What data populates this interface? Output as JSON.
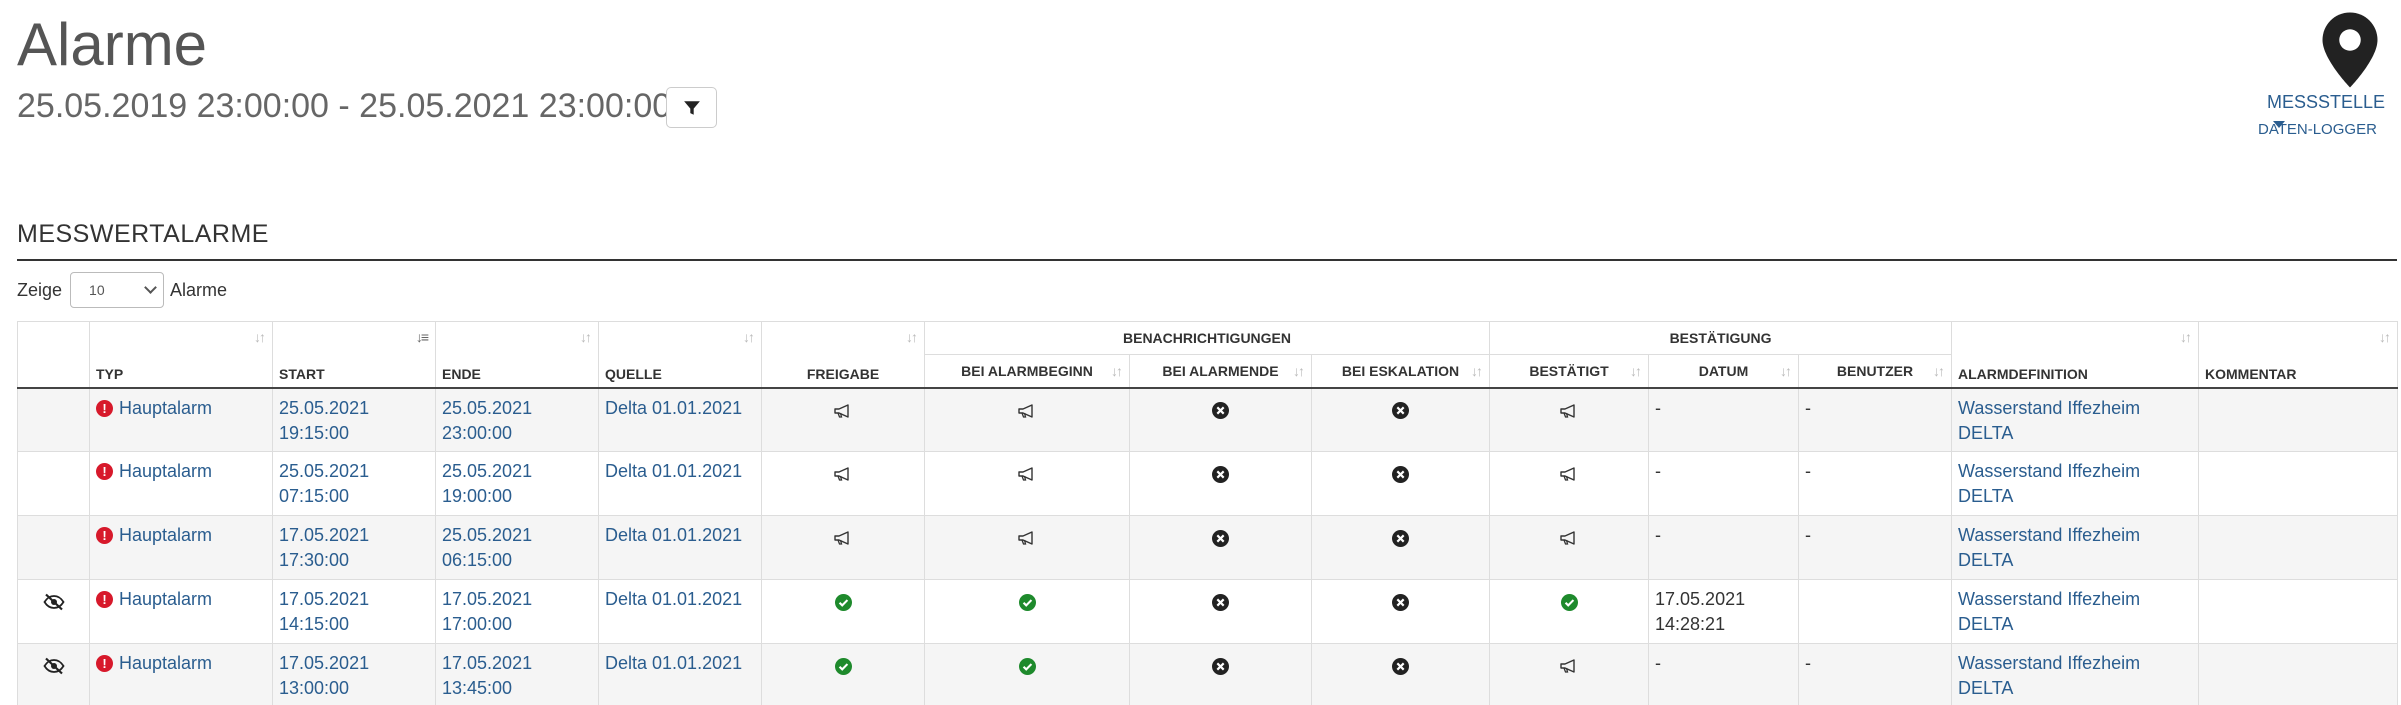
{
  "header": {
    "title": "Alarme",
    "date_range": "25.05.2019 23:00:00 - 25.05.2021 23:00:00",
    "messstelle_label": "MESSSTELLE",
    "datenlogger_label": "DATEN-LOGGER"
  },
  "section": {
    "title": "MESSWERTALARME",
    "length_prefix": "Zeige",
    "length_value": "10",
    "length_suffix": "Alarme"
  },
  "table": {
    "groups": {
      "benachrichtigungen": "BENACHRICHTIGUNGEN",
      "bestaetigung": "BESTÄTIGUNG"
    },
    "columns": {
      "typ": "TYP",
      "start": "START",
      "ende": "ENDE",
      "quelle": "QUELLE",
      "freigabe": "FREIGABE",
      "bei_alarmbeginn": "BEI ALARMBEGINN",
      "bei_alarmende": "BEI ALARMENDE",
      "bei_eskalation": "BEI ESKALATION",
      "bestaetigt": "BESTÄTIGT",
      "datum": "DATUM",
      "benutzer": "BENUTZER",
      "alarmdefinition": "ALARMDEFINITION",
      "kommentar": "KOMMENTAR"
    },
    "rows": [
      {
        "hidden_icon": "none",
        "typ": "Hauptalarm",
        "start_date": "25.05.2021",
        "start_time": "19:15:00",
        "end_date": "25.05.2021",
        "end_time": "23:00:00",
        "quelle": "Delta 01.01.2021",
        "freigabe": "megaphone-icon",
        "bei_alarmbeginn": "megaphone-icon",
        "bei_alarmende": "x-circle-icon",
        "bei_eskalation": "x-circle-icon",
        "bestaetigt": "megaphone-icon",
        "datum_date": "-",
        "datum_time": "",
        "benutzer": "-",
        "alarmdefinition": "Wasserstand Iffezheim DELTA",
        "kommentar": ""
      },
      {
        "hidden_icon": "none",
        "typ": "Hauptalarm",
        "start_date": "25.05.2021",
        "start_time": "07:15:00",
        "end_date": "25.05.2021",
        "end_time": "19:00:00",
        "quelle": "Delta 01.01.2021",
        "freigabe": "megaphone-icon",
        "bei_alarmbeginn": "megaphone-icon",
        "bei_alarmende": "x-circle-icon",
        "bei_eskalation": "x-circle-icon",
        "bestaetigt": "megaphone-icon",
        "datum_date": "-",
        "datum_time": "",
        "benutzer": "-",
        "alarmdefinition": "Wasserstand Iffezheim DELTA",
        "kommentar": ""
      },
      {
        "hidden_icon": "none",
        "typ": "Hauptalarm",
        "start_date": "17.05.2021",
        "start_time": "17:30:00",
        "end_date": "25.05.2021",
        "end_time": "06:15:00",
        "quelle": "Delta 01.01.2021",
        "freigabe": "megaphone-icon",
        "bei_alarmbeginn": "megaphone-icon",
        "bei_alarmende": "x-circle-icon",
        "bei_eskalation": "x-circle-icon",
        "bestaetigt": "megaphone-icon",
        "datum_date": "-",
        "datum_time": "",
        "benutzer": "-",
        "alarmdefinition": "Wasserstand Iffezheim DELTA",
        "kommentar": ""
      },
      {
        "hidden_icon": "eye-slash-icon",
        "typ": "Hauptalarm",
        "start_date": "17.05.2021",
        "start_time": "14:15:00",
        "end_date": "17.05.2021",
        "end_time": "17:00:00",
        "quelle": "Delta 01.01.2021",
        "freigabe": "check-circle-icon",
        "bei_alarmbeginn": "check-circle-icon",
        "bei_alarmende": "x-circle-icon",
        "bei_eskalation": "x-circle-icon",
        "bestaetigt": "check-circle-icon",
        "datum_date": "17.05.2021",
        "datum_time": "14:28:21",
        "benutzer": "",
        "alarmdefinition": "Wasserstand Iffezheim DELTA",
        "kommentar": ""
      },
      {
        "hidden_icon": "eye-slash-icon",
        "typ": "Hauptalarm",
        "start_date": "17.05.2021",
        "start_time": "13:00:00",
        "end_date": "17.05.2021",
        "end_time": "13:45:00",
        "quelle": "Delta 01.01.2021",
        "freigabe": "check-circle-icon",
        "bei_alarmbeginn": "check-circle-icon",
        "bei_alarmende": "x-circle-icon",
        "bei_eskalation": "x-circle-icon",
        "bestaetigt": "megaphone-icon",
        "datum_date": "-",
        "datum_time": "",
        "benutzer": "-",
        "alarmdefinition": "Wasserstand Iffezheim DELTA",
        "kommentar": ""
      }
    ]
  },
  "colors": {
    "link": "#2a5d8f",
    "alarm_red": "#d7192b",
    "check_green": "#1e8a2c",
    "highlight": "#ffff00"
  }
}
